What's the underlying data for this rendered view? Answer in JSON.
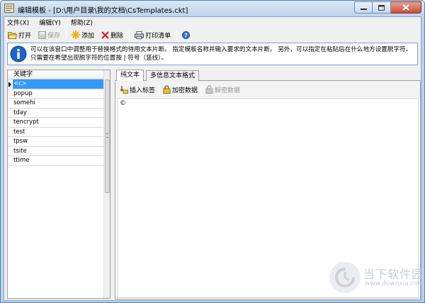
{
  "window": {
    "title": "编辑模板 - [D:\\用户目录\\我的文档\\CsTemplates.ckt]"
  },
  "menu": [
    {
      "label": "文件(X)"
    },
    {
      "label": "编辑(Y)"
    },
    {
      "label": "帮助(Z)"
    }
  ],
  "toolbar": {
    "open": "打开",
    "save": "保存",
    "add": "添加",
    "delete": "删除",
    "print": "打印清单"
  },
  "info": {
    "text": "可以在该窗口中调整用于替换格式的待用文本片断。 指定模板名称并输入要求的文本片断。 另外，可以指定在粘贴后在什么地方设置脱字符。 只需要在希望出现脱字符的位置按 | 符号（竖线）。"
  },
  "keywords": {
    "header": "关键字",
    "items": [
      "<c>",
      "popup",
      "somehi",
      "tday",
      "tencrypt",
      "test",
      "tpsw",
      "tsite",
      "ttime"
    ],
    "selected_index": 0
  },
  "tabs": [
    {
      "label": "纯文本",
      "active": true
    },
    {
      "label": "多信息文本格式",
      "active": false
    }
  ],
  "editor_toolbar": {
    "insert_tag": "插入标签",
    "encrypt": "加密数据",
    "decrypt": "解密数据"
  },
  "editor": {
    "content": "©"
  },
  "watermark": {
    "name": "当下软件园",
    "url": "www.downxia.com"
  },
  "colors": {
    "titlebar": "#bed3ea",
    "selection": "#3399ff",
    "info_icon": "#1e64c8",
    "close_button": "#c7503a"
  }
}
